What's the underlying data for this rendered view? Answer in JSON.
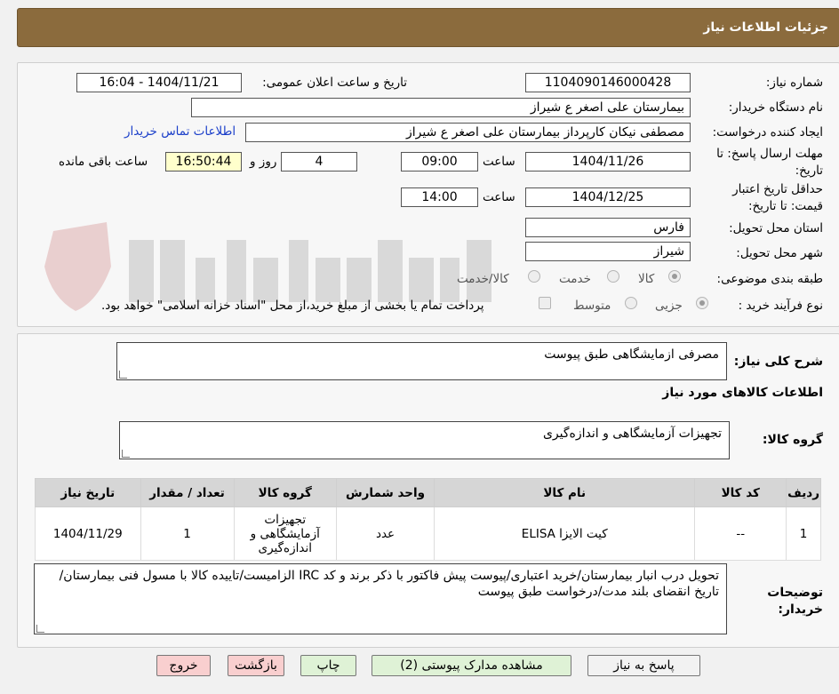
{
  "header": {
    "title": "جزئیات اطلاعات نیاز"
  },
  "fields": {
    "need_number": {
      "label": "شماره نیاز:",
      "value": "1104090146000428"
    },
    "announce_datetime": {
      "label": "تاریخ و ساعت اعلان عمومی:",
      "value": "1404/11/21 - 16:04"
    },
    "buyer_org": {
      "label": "نام دستگاه خریدار:",
      "value": "بیمارستان علی اصغر  ع  شیراز"
    },
    "requester": {
      "label": "ایجاد کننده درخواست:",
      "value": "مصطفی نیکان کارپرداز بیمارستان علی اصغر  ع  شیراز"
    },
    "contact_link": "اطلاعات تماس خریدار",
    "deadline": {
      "label_line1": "مهلت ارسال پاسخ: تا",
      "label_line2": "تاریخ:",
      "date": "1404/11/26",
      "time_label": "ساعت",
      "time": "09:00",
      "days": "4",
      "days_label": "روز و",
      "remaining": "16:50:44",
      "remaining_label": "ساعت باقی مانده"
    },
    "price_validity": {
      "label_line1": "حداقل تاریخ اعتبار",
      "label_line2": "قیمت: تا تاریخ:",
      "date": "1404/12/25",
      "time_label": "ساعت",
      "time": "14:00"
    },
    "province": {
      "label": "استان محل تحویل:",
      "value": "فارس"
    },
    "city": {
      "label": "شهر محل تحویل:",
      "value": "شیراز"
    },
    "category": {
      "label": "طبقه بندی موضوعی:",
      "options": [
        "کالا",
        "خدمت",
        "کالا/خدمت"
      ]
    },
    "purchase_type": {
      "label": "نوع فرآیند خرید :",
      "options": [
        "جزیی",
        "متوسط"
      ],
      "note": "پرداخت تمام یا بخشی از مبلغ خرید،از محل \"اسناد خزانه اسلامی\" خواهد بود."
    }
  },
  "description": {
    "label": "شرح کلی نیاز:",
    "value": "مصرفی ازمایشگاهی طبق پیوست"
  },
  "goods_section_title": "اطلاعات کالاهای مورد نیاز",
  "goods_group": {
    "label": "گروه کالا:",
    "value": "تجهیزات آزمایشگاهی و اندازه‌گیری"
  },
  "table": {
    "headers": [
      "ردیف",
      "کد کالا",
      "نام کالا",
      "واحد شمارش",
      "گروه کالا",
      "تعداد / مقدار",
      "تاریخ نیاز"
    ],
    "rows": [
      [
        "1",
        "--",
        "کیت الایزا ELISA",
        "عدد",
        "تجهیزات آزمایشگاهی و اندازه‌گیری",
        "1",
        "1404/11/29"
      ]
    ]
  },
  "buyer_notes": {
    "label": "توضیحات خریدار:",
    "value": "تحویل درب انبار بیمارستان/خرید اعتباری/پیوست پیش فاکتور با ذکر برند و کد IRC الزامیست/تاییده کالا با مسول فنی بیمارستان/تاریخ انقضای بلند مدت/درخواست طبق پیوست"
  },
  "buttons": {
    "reply": "پاسخ به نیاز",
    "view_docs": "مشاهده مدارک پیوستی (2)",
    "print": "چاپ",
    "back": "بازگشت",
    "exit": "خروج"
  }
}
